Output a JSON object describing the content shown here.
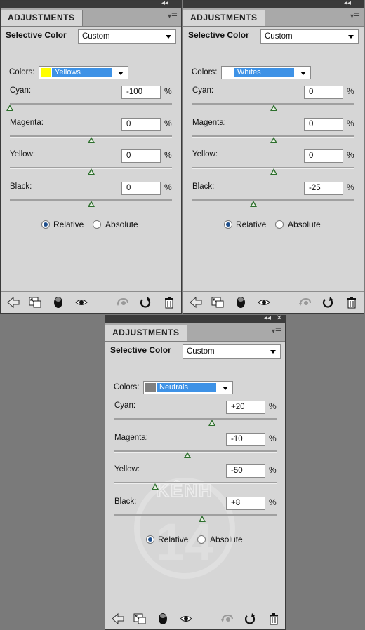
{
  "panels": [
    {
      "tab": "ADJUSTMENTS",
      "title": "Selective Color",
      "preset": "Custom",
      "colors_label": "Colors:",
      "color": "Yellows",
      "swatch": "#ffff00",
      "sliders": [
        {
          "label": "Cyan:",
          "value": "-100",
          "level": -100
        },
        {
          "label": "Magenta:",
          "value": "0",
          "level": 0
        },
        {
          "label": "Yellow:",
          "value": "0",
          "level": 0
        },
        {
          "label": "Black:",
          "value": "0",
          "level": 0
        }
      ],
      "percent": "%",
      "relative": "Relative",
      "absolute": "Absolute",
      "mode": "relative"
    },
    {
      "tab": "ADJUSTMENTS",
      "title": "Selective Color",
      "preset": "Custom",
      "colors_label": "Colors:",
      "color": "Whites",
      "swatch": "#ffffff",
      "sliders": [
        {
          "label": "Cyan:",
          "value": "0",
          "level": 0
        },
        {
          "label": "Magenta:",
          "value": "0",
          "level": 0
        },
        {
          "label": "Yellow:",
          "value": "0",
          "level": 0
        },
        {
          "label": "Black:",
          "value": "-25",
          "level": -25
        }
      ],
      "percent": "%",
      "relative": "Relative",
      "absolute": "Absolute",
      "mode": "relative"
    },
    {
      "tab": "ADJUSTMENTS",
      "title": "Selective Color",
      "preset": "Custom",
      "colors_label": "Colors:",
      "color": "Neutrals",
      "swatch": "#808080",
      "sliders": [
        {
          "label": "Cyan:",
          "value": "+20",
          "level": 20
        },
        {
          "label": "Magenta:",
          "value": "-10",
          "level": -10
        },
        {
          "label": "Yellow:",
          "value": "-50",
          "level": -50
        },
        {
          "label": "Black:",
          "value": "+8",
          "level": 8
        }
      ],
      "percent": "%",
      "relative": "Relative",
      "absolute": "Absolute",
      "mode": "relative"
    }
  ],
  "footer_icons": [
    "back-arrow-icon",
    "expand-view-icon",
    "clip-to-layer-icon",
    "visibility-eye-icon",
    "view-previous-icon",
    "reset-icon",
    "trash-icon"
  ],
  "watermark": "KÊNH 14",
  "colors": {
    "slider_knob": "#2d6f2d",
    "selection": "#3e92e6",
    "panel_bg": "#d6d6d6",
    "backdrop": "#7a7a7a"
  }
}
